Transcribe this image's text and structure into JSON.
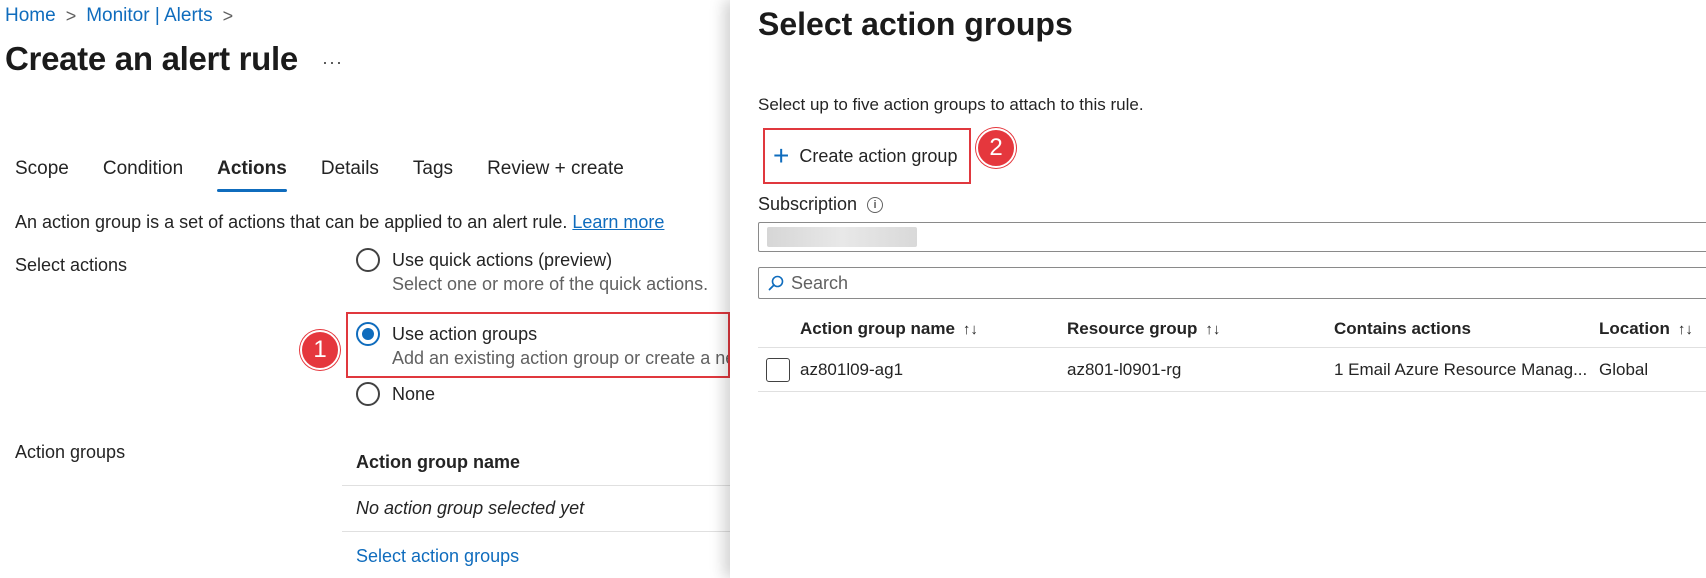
{
  "breadcrumb": {
    "home": "Home",
    "section": "Monitor | Alerts"
  },
  "page": {
    "title": "Create an alert rule",
    "more": "···"
  },
  "tabs": [
    {
      "label": "Scope",
      "active": false
    },
    {
      "label": "Condition",
      "active": false
    },
    {
      "label": "Actions",
      "active": true
    },
    {
      "label": "Details",
      "active": false
    },
    {
      "label": "Tags",
      "active": false
    },
    {
      "label": "Review + create",
      "active": false
    }
  ],
  "actions": {
    "description": "An action group is a set of actions that can be applied to an alert rule.",
    "learn_more": "Learn more",
    "select_actions_label": "Select actions",
    "options": [
      {
        "title": "Use quick actions (preview)",
        "subtitle": "Select one or more of the quick actions.",
        "checked": false
      },
      {
        "title": "Use action groups",
        "subtitle": "Add an existing action group or create a ne",
        "checked": true
      },
      {
        "title": "None",
        "subtitle": "",
        "checked": false
      }
    ],
    "action_groups_label": "Action groups",
    "table_header": "Action group name",
    "empty_text": "No action group selected yet",
    "select_link": "Select action groups"
  },
  "callouts": {
    "one": "1",
    "two": "2"
  },
  "panel": {
    "title": "Select action groups",
    "description": "Select up to five action groups to attach to this rule.",
    "create_button": "Create action group",
    "subscription_label": "Subscription",
    "search_placeholder": "Search",
    "columns": {
      "name": "Action group name",
      "resource_group": "Resource group",
      "contains_actions": "Contains actions",
      "location": "Location",
      "sort_glyph": "↑↓"
    },
    "rows": [
      {
        "name": "az801l09-ag1",
        "resource_group": "az801-l0901-rg",
        "contains_actions": "1 Email Azure Resource Manag...",
        "location": "Global"
      }
    ]
  },
  "icons": {
    "plus": "+",
    "info": "i",
    "chevron": ">"
  },
  "colors": {
    "accent": "#0f6cbd",
    "callout": "#e5373d"
  }
}
